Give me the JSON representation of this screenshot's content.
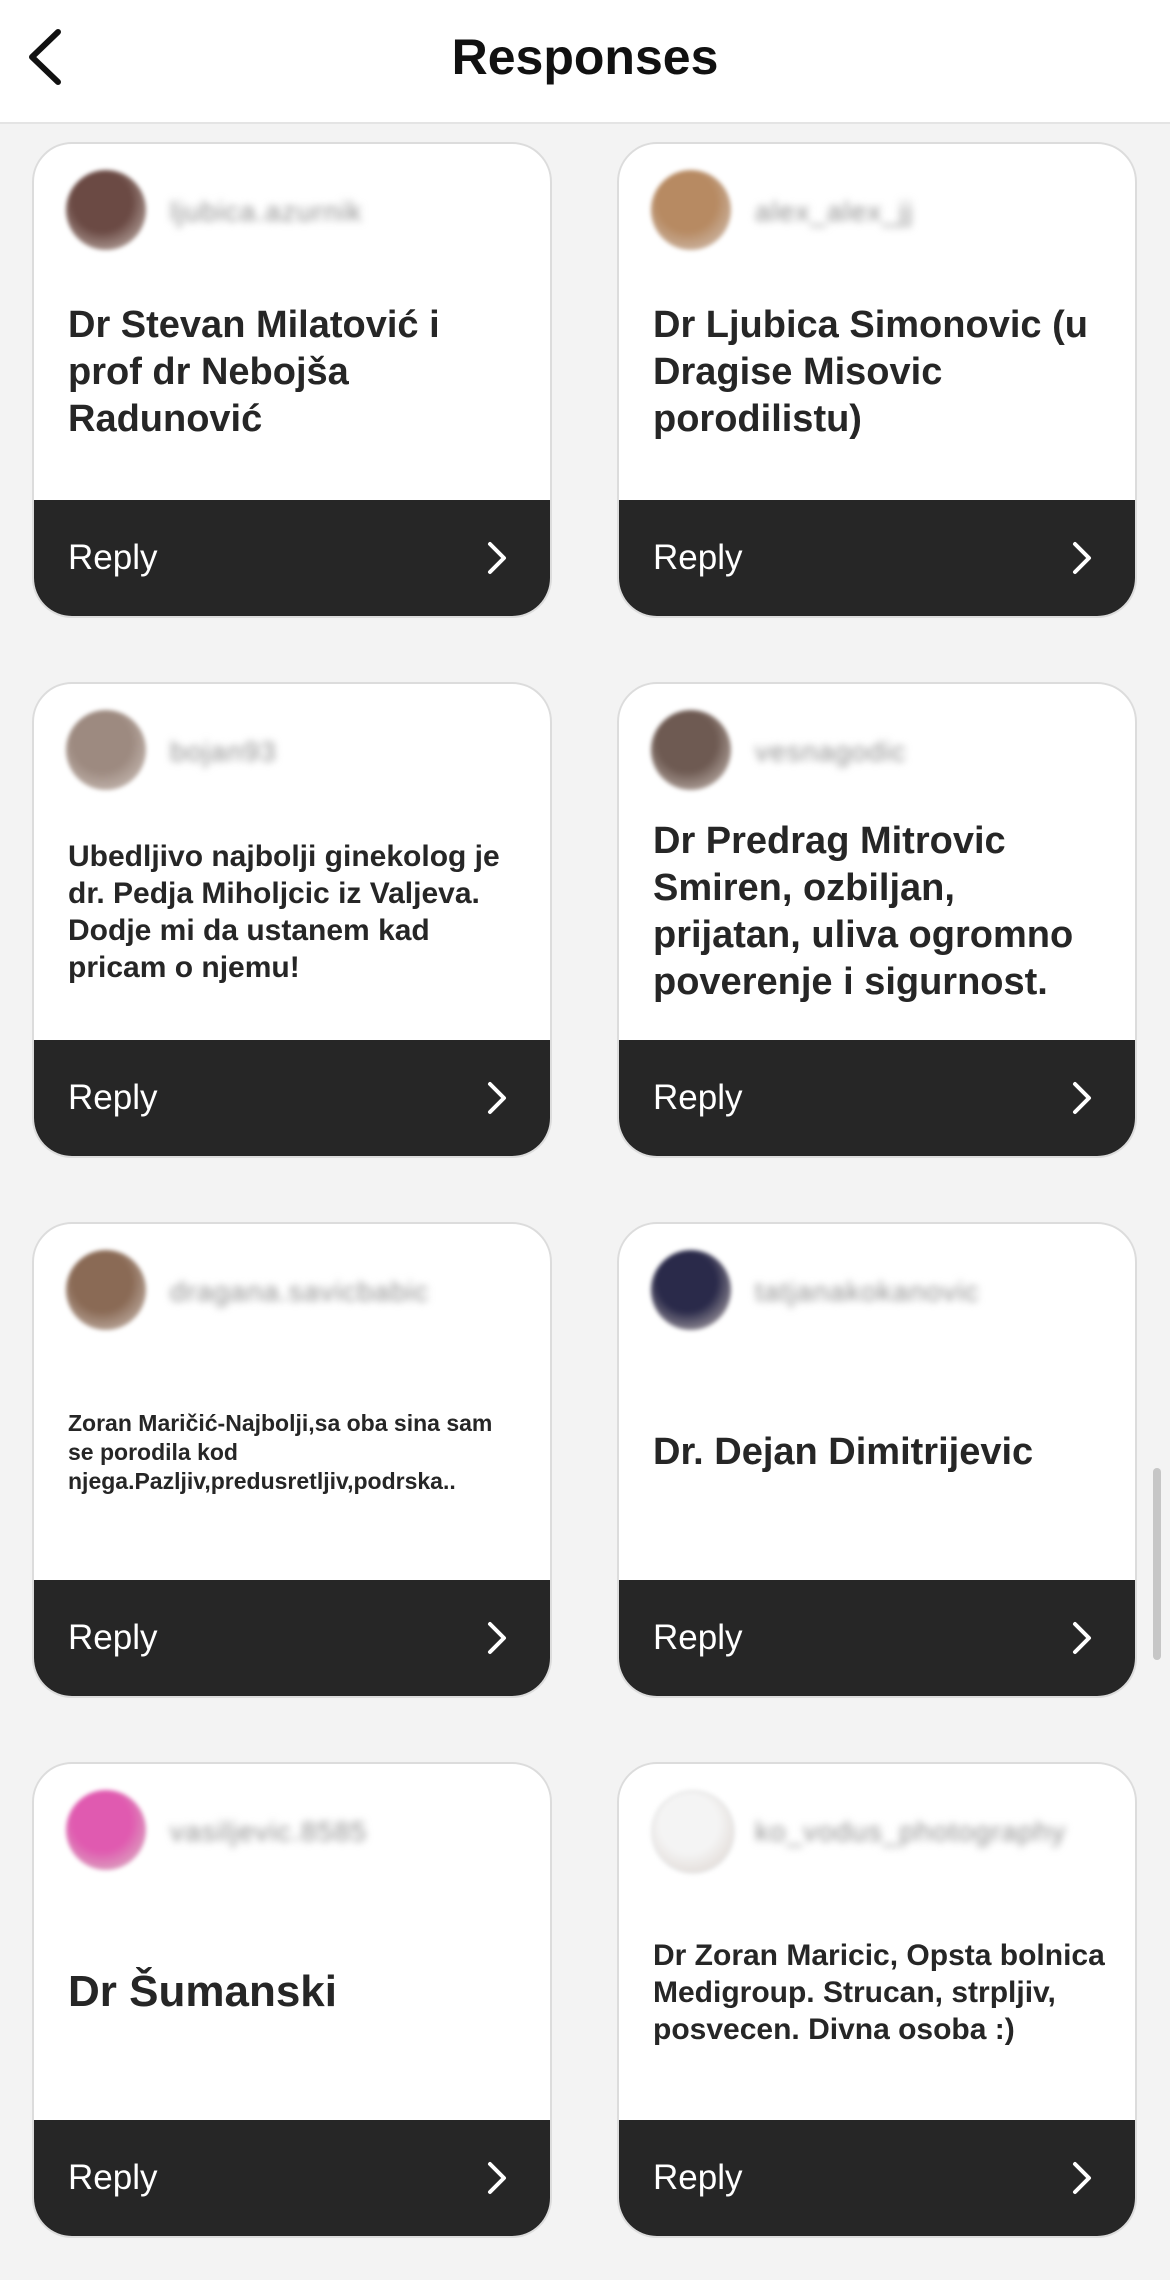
{
  "header": {
    "title": "Responses",
    "back_icon": "chevron-left-icon"
  },
  "cards": [
    {
      "username": "ljubica.azurnik",
      "avatar_color": "#6b4a44",
      "text": "Dr Stevan Milatović i prof dr Nebojša Radunović",
      "size": "lg",
      "reply_label": "Reply"
    },
    {
      "username": "alex_alex_jj",
      "avatar_color": "#b78a62",
      "text": "Dr Ljubica Simonovic (u Dragise Misovic porodilistu)",
      "size": "lg",
      "reply_label": "Reply"
    },
    {
      "username": "bojan93",
      "avatar_color": "#9d8a80",
      "text": "Ubedljivo najbolji ginekolog je dr. Pedja Miholjcic iz Valjeva. Dodje mi da ustanem kad pricam o njemu!",
      "size": "md",
      "reply_label": "Reply"
    },
    {
      "username": "vesnagodic",
      "avatar_color": "#6e5a52",
      "text": "Dr Predrag Mitrovic Smiren, ozbiljan, prijatan, uliva ogromno poverenje i sigurnost.",
      "size": "lg",
      "reply_label": "Reply"
    },
    {
      "username": "dragana.savicbabic",
      "avatar_color": "#8a6a55",
      "text": "Zoran Maričić-Najbolji,sa oba sina sam se porodila kod njega.Pazljiv,predusretljiv,podrska..",
      "size": "sm",
      "reply_label": "Reply"
    },
    {
      "username": "tatjanakokanovic",
      "avatar_color": "#2a2a4a",
      "text": "Dr. Dejan Dimitrijevic",
      "size": "lg",
      "reply_label": "Reply"
    },
    {
      "username": "vasiljevic.8585",
      "avatar_color": "#e05ab0",
      "text": "Dr Šumanski",
      "size": "xl",
      "reply_label": "Reply"
    },
    {
      "username": "ko_vodus_photography",
      "avatar_color": "#f4f4f4",
      "text": "Dr Zoran Maricic, Opsta bolnica Medigroup. Strucan, strpljiv, posvecen. Divna osoba :)",
      "size": "md",
      "reply_label": "Reply"
    }
  ]
}
